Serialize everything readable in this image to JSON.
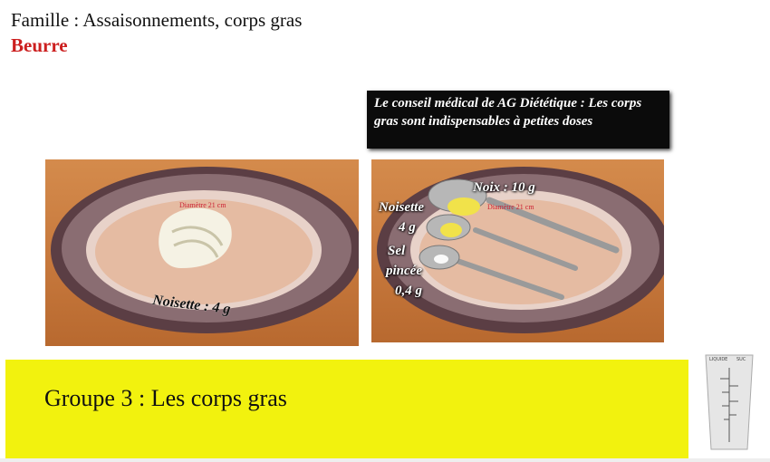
{
  "header": {
    "famille": "Famille : Assaisonnements, corps gras",
    "aliment": "Beurre"
  },
  "conseil": {
    "text": "Le conseil médical de AG Diététique : Les corps gras sont indispensables à petites doses"
  },
  "left_plate": {
    "rim_text": "Diamètre 21 cm",
    "portion_label": "Noisette : 4 g"
  },
  "right_plate": {
    "rim_text": "Diamètre 21 cm",
    "noix_label": "Noix : 10 g",
    "noisette_label_1": "Noisette",
    "noisette_label_2": "4 g",
    "sel_label_1": "Sel",
    "sel_label_2": "pincée",
    "sel_label_3": "0,4 g"
  },
  "groupe": {
    "title": "Groupe 3 : Les corps gras"
  },
  "cup": {
    "label_left": "LIQUIDE",
    "label_right": "SUC"
  },
  "colors": {
    "accent_red": "#cc1f1f",
    "banner_yellow": "#f2f20e",
    "conseil_bg": "#0b0b0b"
  }
}
